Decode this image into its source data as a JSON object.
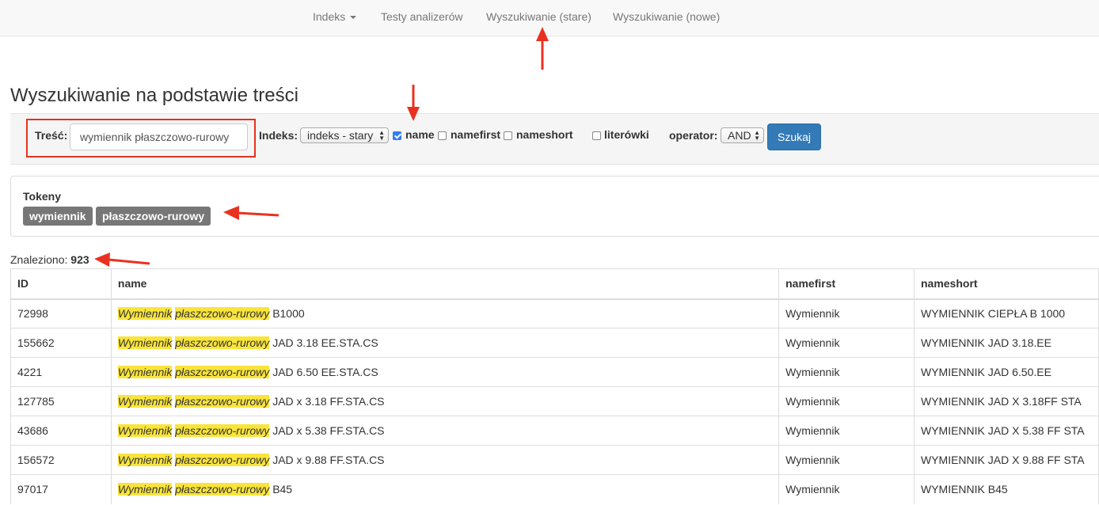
{
  "nav": {
    "items": [
      {
        "label": "Indeks"
      },
      {
        "label": "Testy analizerów"
      },
      {
        "label": "Wyszukiwanie (stare)"
      },
      {
        "label": "Wyszukiwanie (nowe)"
      }
    ]
  },
  "page_title": "Wyszukiwanie na podstawie treści",
  "search": {
    "tresc_label": "Treść:",
    "tresc_value": "wymiennik płaszczowo-rurowy",
    "indeks_label": "Indeks:",
    "indeks_selected": "indeks - stary",
    "checkboxes": [
      {
        "label": "name",
        "checked": true
      },
      {
        "label": "namefirst",
        "checked": false
      },
      {
        "label": "nameshort",
        "checked": false
      },
      {
        "label": "literówki",
        "checked": false
      }
    ],
    "operator_label": "operator:",
    "operator_selected": "AND",
    "submit_label": "Szukaj"
  },
  "tokens": {
    "heading": "Tokeny",
    "items": [
      "wymiennik",
      "płaszczowo-rurowy"
    ]
  },
  "results": {
    "found_label": "Znaleziono:",
    "found_count": "923",
    "columns": [
      "ID",
      "name",
      "namefirst",
      "nameshort"
    ],
    "rows": [
      {
        "id": "72998",
        "hl1": "Wymiennik",
        "hl2": "płaszczowo-rurowy",
        "rest": "B1000",
        "namefirst": "Wymiennik",
        "nameshort": "WYMIENNIK CIEPŁA B 1000"
      },
      {
        "id": "155662",
        "hl1": "Wymiennik",
        "hl2": "płaszczowo-rurowy",
        "rest": "JAD 3.18 EE.STA.CS",
        "namefirst": "Wymiennik",
        "nameshort": "WYMIENNIK JAD 3.18.EE"
      },
      {
        "id": "4221",
        "hl1": "Wymiennik",
        "hl2": "płaszczowo-rurowy",
        "rest": "JAD 6.50 EE.STA.CS",
        "namefirst": "Wymiennik",
        "nameshort": "WYMIENNIK JAD 6.50.EE"
      },
      {
        "id": "127785",
        "hl1": "Wymiennik",
        "hl2": "płaszczowo-rurowy",
        "rest": "JAD x 3.18 FF.STA.CS",
        "namefirst": "Wymiennik",
        "nameshort": "WYMIENNIK JAD X 3.18FF STA"
      },
      {
        "id": "43686",
        "hl1": "Wymiennik",
        "hl2": "płaszczowo-rurowy",
        "rest": "JAD x 5.38 FF.STA.CS",
        "namefirst": "Wymiennik",
        "nameshort": "WYMIENNIK JAD X 5.38 FF STA"
      },
      {
        "id": "156572",
        "hl1": "Wymiennik",
        "hl2": "płaszczowo-rurowy",
        "rest": "JAD x 9.88 FF.STA.CS",
        "namefirst": "Wymiennik",
        "nameshort": "WYMIENNIK JAD X 9.88 FF STA"
      },
      {
        "id": "97017",
        "hl1": "Wymiennik",
        "hl2": "płaszczowo-rurowy",
        "rest": "B45",
        "namefirst": "Wymiennik",
        "nameshort": "WYMIENNIK B45"
      }
    ]
  },
  "colors": {
    "highlight": "#f9e43b",
    "annotation": "#e8321f",
    "primary_button": "#337ab7",
    "badge": "#777777"
  }
}
